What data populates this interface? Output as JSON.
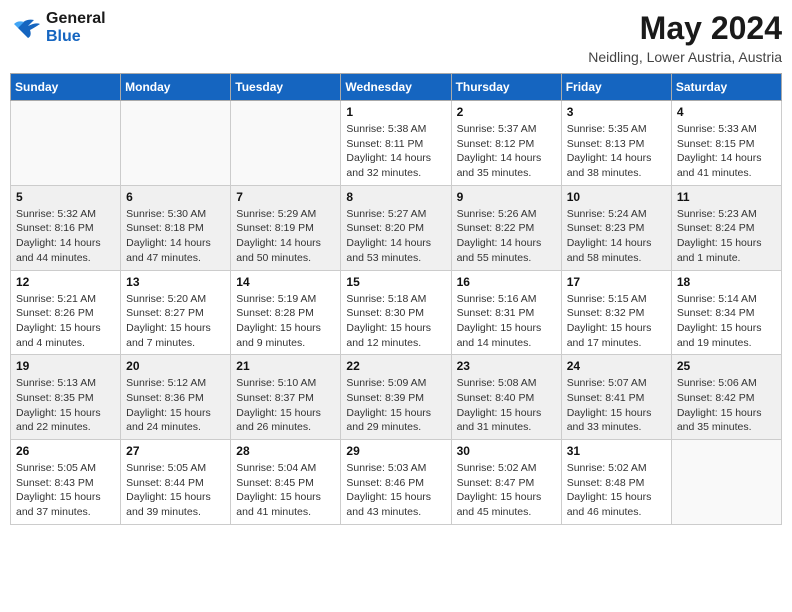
{
  "header": {
    "logo_line1": "General",
    "logo_line2": "Blue",
    "month_year": "May 2024",
    "location": "Neidling, Lower Austria, Austria"
  },
  "weekdays": [
    "Sunday",
    "Monday",
    "Tuesday",
    "Wednesday",
    "Thursday",
    "Friday",
    "Saturday"
  ],
  "weeks": [
    [
      {
        "day": "",
        "info": ""
      },
      {
        "day": "",
        "info": ""
      },
      {
        "day": "",
        "info": ""
      },
      {
        "day": "1",
        "info": "Sunrise: 5:38 AM\nSunset: 8:11 PM\nDaylight: 14 hours\nand 32 minutes."
      },
      {
        "day": "2",
        "info": "Sunrise: 5:37 AM\nSunset: 8:12 PM\nDaylight: 14 hours\nand 35 minutes."
      },
      {
        "day": "3",
        "info": "Sunrise: 5:35 AM\nSunset: 8:13 PM\nDaylight: 14 hours\nand 38 minutes."
      },
      {
        "day": "4",
        "info": "Sunrise: 5:33 AM\nSunset: 8:15 PM\nDaylight: 14 hours\nand 41 minutes."
      }
    ],
    [
      {
        "day": "5",
        "info": "Sunrise: 5:32 AM\nSunset: 8:16 PM\nDaylight: 14 hours\nand 44 minutes."
      },
      {
        "day": "6",
        "info": "Sunrise: 5:30 AM\nSunset: 8:18 PM\nDaylight: 14 hours\nand 47 minutes."
      },
      {
        "day": "7",
        "info": "Sunrise: 5:29 AM\nSunset: 8:19 PM\nDaylight: 14 hours\nand 50 minutes."
      },
      {
        "day": "8",
        "info": "Sunrise: 5:27 AM\nSunset: 8:20 PM\nDaylight: 14 hours\nand 53 minutes."
      },
      {
        "day": "9",
        "info": "Sunrise: 5:26 AM\nSunset: 8:22 PM\nDaylight: 14 hours\nand 55 minutes."
      },
      {
        "day": "10",
        "info": "Sunrise: 5:24 AM\nSunset: 8:23 PM\nDaylight: 14 hours\nand 58 minutes."
      },
      {
        "day": "11",
        "info": "Sunrise: 5:23 AM\nSunset: 8:24 PM\nDaylight: 15 hours\nand 1 minute."
      }
    ],
    [
      {
        "day": "12",
        "info": "Sunrise: 5:21 AM\nSunset: 8:26 PM\nDaylight: 15 hours\nand 4 minutes."
      },
      {
        "day": "13",
        "info": "Sunrise: 5:20 AM\nSunset: 8:27 PM\nDaylight: 15 hours\nand 7 minutes."
      },
      {
        "day": "14",
        "info": "Sunrise: 5:19 AM\nSunset: 8:28 PM\nDaylight: 15 hours\nand 9 minutes."
      },
      {
        "day": "15",
        "info": "Sunrise: 5:18 AM\nSunset: 8:30 PM\nDaylight: 15 hours\nand 12 minutes."
      },
      {
        "day": "16",
        "info": "Sunrise: 5:16 AM\nSunset: 8:31 PM\nDaylight: 15 hours\nand 14 minutes."
      },
      {
        "day": "17",
        "info": "Sunrise: 5:15 AM\nSunset: 8:32 PM\nDaylight: 15 hours\nand 17 minutes."
      },
      {
        "day": "18",
        "info": "Sunrise: 5:14 AM\nSunset: 8:34 PM\nDaylight: 15 hours\nand 19 minutes."
      }
    ],
    [
      {
        "day": "19",
        "info": "Sunrise: 5:13 AM\nSunset: 8:35 PM\nDaylight: 15 hours\nand 22 minutes."
      },
      {
        "day": "20",
        "info": "Sunrise: 5:12 AM\nSunset: 8:36 PM\nDaylight: 15 hours\nand 24 minutes."
      },
      {
        "day": "21",
        "info": "Sunrise: 5:10 AM\nSunset: 8:37 PM\nDaylight: 15 hours\nand 26 minutes."
      },
      {
        "day": "22",
        "info": "Sunrise: 5:09 AM\nSunset: 8:39 PM\nDaylight: 15 hours\nand 29 minutes."
      },
      {
        "day": "23",
        "info": "Sunrise: 5:08 AM\nSunset: 8:40 PM\nDaylight: 15 hours\nand 31 minutes."
      },
      {
        "day": "24",
        "info": "Sunrise: 5:07 AM\nSunset: 8:41 PM\nDaylight: 15 hours\nand 33 minutes."
      },
      {
        "day": "25",
        "info": "Sunrise: 5:06 AM\nSunset: 8:42 PM\nDaylight: 15 hours\nand 35 minutes."
      }
    ],
    [
      {
        "day": "26",
        "info": "Sunrise: 5:05 AM\nSunset: 8:43 PM\nDaylight: 15 hours\nand 37 minutes."
      },
      {
        "day": "27",
        "info": "Sunrise: 5:05 AM\nSunset: 8:44 PM\nDaylight: 15 hours\nand 39 minutes."
      },
      {
        "day": "28",
        "info": "Sunrise: 5:04 AM\nSunset: 8:45 PM\nDaylight: 15 hours\nand 41 minutes."
      },
      {
        "day": "29",
        "info": "Sunrise: 5:03 AM\nSunset: 8:46 PM\nDaylight: 15 hours\nand 43 minutes."
      },
      {
        "day": "30",
        "info": "Sunrise: 5:02 AM\nSunset: 8:47 PM\nDaylight: 15 hours\nand 45 minutes."
      },
      {
        "day": "31",
        "info": "Sunrise: 5:02 AM\nSunset: 8:48 PM\nDaylight: 15 hours\nand 46 minutes."
      },
      {
        "day": "",
        "info": ""
      }
    ]
  ]
}
